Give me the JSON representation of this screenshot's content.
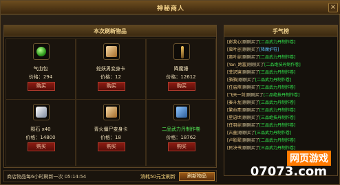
{
  "window": {
    "title": "神秘商人"
  },
  "shop": {
    "panel_title": "本次刷新物品",
    "items": [
      {
        "name": "气血包",
        "price_label": "价格：",
        "price": "294",
        "buy_label": "购买",
        "icon": "potion-icon"
      },
      {
        "name": "蛇妖男变身卡",
        "price_label": "价格：",
        "price": "12",
        "buy_label": "购买",
        "icon": "transform-card-icon"
      },
      {
        "name": "降魔锤",
        "price_label": "价格：",
        "price": "12612",
        "buy_label": "购买",
        "icon": "weapon-icon"
      },
      {
        "name": "陨石 x40",
        "price_label": "价格：",
        "price": "14800",
        "buy_label": "购买",
        "icon": "meteorite-icon"
      },
      {
        "name": "青火僵尸变身卡",
        "price_label": "价格：",
        "price": "18",
        "buy_label": "购买",
        "icon": "transform-card-icon"
      },
      {
        "name": "二品武力丹制作卷",
        "price_label": "价格：",
        "price": "18762",
        "buy_label": "购买",
        "icon": "recipe-icon"
      }
    ],
    "footer_text": "商店物品每6小时刷新一次",
    "footer_time": "05:14:54",
    "cost_text": "消耗50元宝刷新",
    "refresh_button": "刷新物品"
  },
  "luck": {
    "panel_title": "手气榜",
    "entries": [
      {
        "buyer": "[彭我心]",
        "verb": "刚刚买了",
        "item": "[二品武力丹制作卷]",
        "item_color": "green"
      },
      {
        "buyer": "[蛮叶谷]",
        "verb": "刚刚买了",
        "item": "[降魔护符]",
        "item_color": "blue"
      },
      {
        "buyer": "[蛮叶谷]",
        "verb": "刚刚买了",
        "item": "[二品武力丹制作卷]",
        "item_color": "green"
      },
      {
        "buyer": "[Yan_跨富]",
        "verb": "刚刚买了",
        "item": "[二品绝技丹制作卷]",
        "item_color": "green"
      },
      {
        "buyer": "[菲沢旗]",
        "verb": "刚刚买了",
        "item": "[三品武力丹制作卷]",
        "item_color": "green"
      },
      {
        "buyer": "[骆骆]",
        "verb": "刚刚买了",
        "item": "[二品武力丹制作卷]",
        "item_color": "green"
      },
      {
        "buyer": "[任庙帅]",
        "verb": "刚刚买了",
        "item": "[三品武力丹制作卷]",
        "item_color": "green"
      },
      {
        "buyer": "[飞天一剑]",
        "verb": "刚刚买了",
        "item": "[二品绝技丹制作卷]",
        "item_color": "green"
      },
      {
        "buyer": "[秦斗龙]",
        "verb": "刚刚买了",
        "item": "[三品武力丹制作卷]",
        "item_color": "green"
      },
      {
        "buyer": "[繁血青]",
        "verb": "刚刚买了",
        "item": "[三品武力丹制作卷]",
        "item_color": "green"
      },
      {
        "buyer": "[星语世]",
        "verb": "刚刚买了",
        "item": "[三品绝技丹制作卷]",
        "item_color": "green"
      },
      {
        "buyer": "[任羽谷]",
        "verb": "刚刚买了",
        "item": "[三品武力丹制作卷]",
        "item_color": "green"
      },
      {
        "buyer": "[古童]",
        "verb": "刚刚买了",
        "item": "[三品武力丹制作卷]",
        "item_color": "green"
      },
      {
        "buyer": "[卢影翠]",
        "verb": "刚刚买了",
        "item": "[二品武力丹制作卷]",
        "item_color": "green"
      },
      {
        "buyer": "[民决书]",
        "verb": "刚刚买了",
        "item": "[三品武力丹制作卷]",
        "item_color": "green"
      }
    ]
  },
  "watermark": {
    "line1": "网页游戏",
    "line2": "07073.com"
  }
}
